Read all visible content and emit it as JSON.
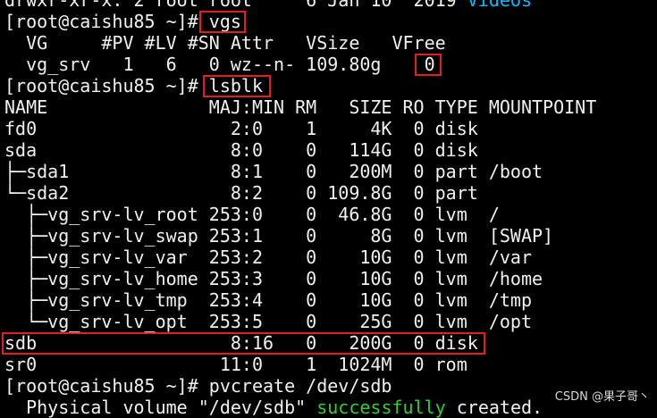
{
  "terminal": {
    "lines": [
      {
        "pre": "drwxr-xr-x. 2 root root     6 Jan 10  2019 ",
        "dir": "Videos"
      },
      {
        "text": "[root@caishu85 ~]# vgs"
      },
      {
        "text": "  VG     #PV #LV #SN Attr   VSize   VFree"
      },
      {
        "text": "  vg_srv   1   6   0 wz--n- 109.80g    0"
      },
      {
        "text": "[root@caishu85 ~]# lsblk"
      },
      {
        "text": "NAME               MAJ:MIN RM   SIZE RO TYPE MOUNTPOINT"
      },
      {
        "text": "fd0                  2:0    1     4K  0 disk"
      },
      {
        "text": "sda                  8:0    0   114G  0 disk"
      },
      {
        "text": "├─sda1               8:1    0   200M  0 part /boot"
      },
      {
        "text": "└─sda2               8:2    0 109.8G  0 part"
      },
      {
        "text": "  ├─vg_srv-lv_root 253:0    0  46.8G  0 lvm  /"
      },
      {
        "text": "  ├─vg_srv-lv_swap 253:1    0     8G  0 lvm  [SWAP]"
      },
      {
        "text": "  ├─vg_srv-lv_var  253:2    0    10G  0 lvm  /var"
      },
      {
        "text": "  ├─vg_srv-lv_home 253:3    0    10G  0 lvm  /home"
      },
      {
        "text": "  ├─vg_srv-lv_tmp  253:4    0    10G  0 lvm  /tmp"
      },
      {
        "text": "  └─vg_srv-lv_opt  253:5    0    25G  0 lvm  /opt"
      },
      {
        "text": "sdb                  8:16   0   200G  0 disk"
      },
      {
        "text": "sr0                 11:0    1  1024M  0 rom"
      },
      {
        "text": "[root@caishu85 ~]# pvcreate /dev/sdb"
      },
      {
        "pre": "  Physical volume \"/dev/sdb\" ",
        "green": "successfully",
        "post": " created."
      }
    ]
  },
  "watermark": "CSDN @果子哥丶",
  "colors": {
    "background": "#000000",
    "text": "#f0f0f0",
    "directory": "#00bbff",
    "success": "#33cc33",
    "highlight_box": "#e02020"
  }
}
